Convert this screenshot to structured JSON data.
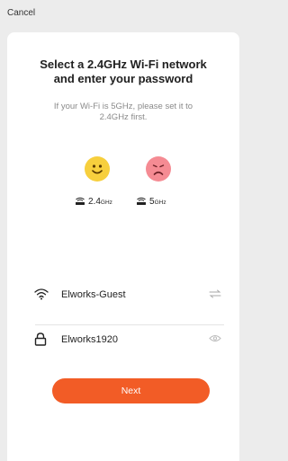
{
  "topbar": {
    "back_label": "Cancel"
  },
  "heading": {
    "title": "Select a 2.4GHz Wi-Fi network\nand enter your password"
  },
  "hint": {
    "text": "If your Wi-Fi is 5GHz, please set it to\n2.4GHz first."
  },
  "bands": [
    {
      "value": "2.4",
      "unit": "GHz",
      "status": "supported",
      "face_color": "#f7cf3d",
      "icon": "happy-face-icon"
    },
    {
      "value": "5",
      "unit": "GHz",
      "status": "unsupported",
      "face_color": "#f58b93",
      "icon": "sad-face-icon"
    }
  ],
  "form": {
    "ssid": {
      "value": "Elworks-Guest",
      "left_icon": "wifi-icon",
      "right_icon": "switch-network-icon"
    },
    "password": {
      "value": "Elworks1920",
      "left_icon": "lock-icon",
      "right_icon": "show-password-icon"
    }
  },
  "actions": {
    "next_label": "Next"
  },
  "colors": {
    "accent": "#f25c26",
    "happy": "#f7cf3d",
    "sad": "#f58b93",
    "background": "#ececec"
  }
}
